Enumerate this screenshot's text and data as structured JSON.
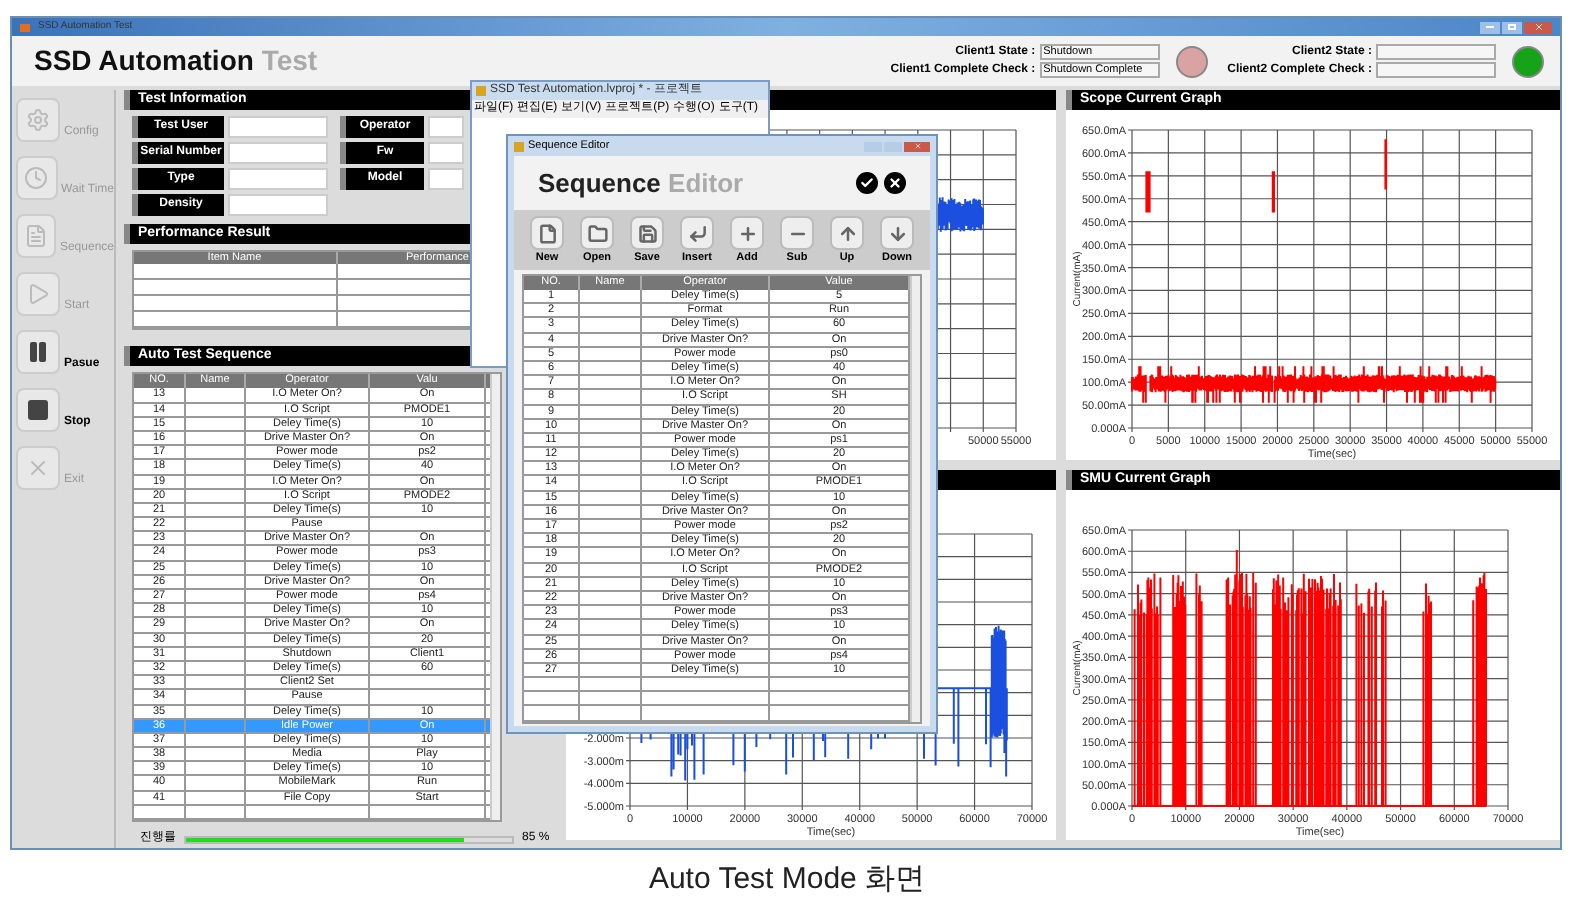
{
  "window": {
    "title": "SSD Automation Test"
  },
  "header": {
    "title": "SSD Automation",
    "title_suffix": "Test"
  },
  "clients": [
    {
      "state_label": "Client1 State :",
      "state": "Shutdown",
      "check_label": "Client1 Complete Check :",
      "check": "Shutdown Complete",
      "color": "#d9a3a3"
    },
    {
      "state_label": "Client2 State :",
      "check_label": "Client2 Complete Check :",
      "color": "#17a317"
    }
  ],
  "sidebar": [
    {
      "label": "Config",
      "disabled": true
    },
    {
      "label": "Wait Time",
      "disabled": true
    },
    {
      "label": "Sequence",
      "disabled": true
    },
    {
      "label": "Start",
      "disabled": true
    },
    {
      "label": "Pasue",
      "disabled": false
    },
    {
      "label": "Stop",
      "disabled": false
    },
    {
      "label": "Exit",
      "disabled": true
    }
  ],
  "test_information": {
    "title": "Test Information",
    "left_fields": [
      {
        "label": "Test User"
      },
      {
        "label": "Serial Number"
      },
      {
        "label": "Type"
      },
      {
        "label": "Density"
      }
    ],
    "right_fields": [
      {
        "label": "Operator"
      },
      {
        "label": "Fw"
      },
      {
        "label": "Model"
      }
    ]
  },
  "performance_result": {
    "title": "Performance Result",
    "columns": [
      "Item Name",
      "Performance"
    ]
  },
  "auto_test_sequence": {
    "title": "Auto Test Sequence",
    "columns": [
      "NO.",
      "Name",
      "Operator",
      "Valu"
    ],
    "rows": [
      {
        "no": "13",
        "operator": "I.O Meter On?",
        "value": "On",
        "selected": false
      },
      {
        "no": "14",
        "operator": "I.O Script",
        "value": "PMODE1",
        "selected": false
      },
      {
        "no": "15",
        "operator": "Deley Time(s)",
        "value": "10",
        "selected": false
      },
      {
        "no": "16",
        "operator": "Drive Master On?",
        "value": "On",
        "selected": false
      },
      {
        "no": "17",
        "operator": "Power mode",
        "value": "ps2",
        "selected": false
      },
      {
        "no": "18",
        "operator": "Deley Time(s)",
        "value": "40",
        "selected": false
      },
      {
        "no": "19",
        "operator": "I.O Meter On?",
        "value": "On",
        "selected": false
      },
      {
        "no": "20",
        "operator": "I.O Script",
        "value": "PMODE2",
        "selected": false
      },
      {
        "no": "21",
        "operator": "Deley Time(s)",
        "value": "10",
        "selected": false
      },
      {
        "no": "22",
        "operator": "Pause",
        "selected": false
      },
      {
        "no": "23",
        "operator": "Drive Master On?",
        "value": "On",
        "selected": false
      },
      {
        "no": "24",
        "operator": "Power mode",
        "value": "ps3",
        "selected": false
      },
      {
        "no": "25",
        "operator": "Deley Time(s)",
        "value": "10",
        "selected": false
      },
      {
        "no": "26",
        "operator": "Drive Master On?",
        "value": "On",
        "selected": false
      },
      {
        "no": "27",
        "operator": "Power mode",
        "value": "ps4",
        "selected": false
      },
      {
        "no": "28",
        "operator": "Deley Time(s)",
        "value": "10",
        "selected": false
      },
      {
        "no": "29",
        "operator": "Drive Master On?",
        "value": "On",
        "selected": false
      },
      {
        "no": "30",
        "operator": "Deley Time(s)",
        "value": "20",
        "selected": false
      },
      {
        "no": "31",
        "operator": "Shutdown",
        "value": "Client1",
        "selected": false
      },
      {
        "no": "32",
        "operator": "Deley Time(s)",
        "value": "60",
        "selected": false
      },
      {
        "no": "33",
        "operator": "Client2 Set",
        "selected": false
      },
      {
        "no": "34",
        "operator": "Pause",
        "selected": false
      },
      {
        "no": "35",
        "operator": "Deley Time(s)",
        "value": "10",
        "selected": false
      },
      {
        "no": "36",
        "operator": "Idle Power",
        "value": "On",
        "selected": true
      },
      {
        "no": "37",
        "operator": "Deley Time(s)",
        "value": "10",
        "selected": false
      },
      {
        "no": "38",
        "operator": "Media",
        "value": "Play",
        "selected": false
      },
      {
        "no": "39",
        "operator": "Deley Time(s)",
        "value": "10",
        "selected": false
      },
      {
        "no": "40",
        "operator": "MobileMark",
        "value": "Run",
        "selected": false
      },
      {
        "no": "41",
        "operator": "File Copy",
        "value": "Start",
        "selected": false
      }
    ],
    "progress": {
      "label": "진행률",
      "level": 0.85,
      "reading": "85 %"
    }
  },
  "middle_top_graph": {
    "x_ticks": [
      "50000",
      "55000"
    ]
  },
  "middle_bottom_graph": {
    "y_ticks": [
      "-2.000m",
      "-3.000m",
      "-4.000m",
      "-5.000m"
    ],
    "x_ticks": [
      "0",
      "10000",
      "20000",
      "30000",
      "40000",
      "50000",
      "60000",
      "70000"
    ],
    "xlabel": "Time(sec)"
  },
  "scope_graph": {
    "title": "Scope Current Graph",
    "ylabel": "Current(mA)",
    "xlabel": "Time(sec)",
    "y_ticks": [
      "650.0mA",
      "600.0mA",
      "550.0mA",
      "500.0mA",
      "450.0mA",
      "400.0mA",
      "350.0mA",
      "300.0mA",
      "250.0mA",
      "200.0mA",
      "150.0mA",
      "100.0mA",
      "50.00mA",
      "0.000A"
    ],
    "x_ticks": [
      "0",
      "5000",
      "10000",
      "15000",
      "20000",
      "25000",
      "30000",
      "35000",
      "40000",
      "45000",
      "50000",
      "55000"
    ]
  },
  "smu_graph": {
    "title": "SMU Current Graph",
    "ylabel": "Current(mA)",
    "xlabel": "Time(sec)",
    "y_ticks": [
      "650.0mA",
      "600.0mA",
      "550.0mA",
      "500.0mA",
      "450.0mA",
      "400.0mA",
      "350.0mA",
      "300.0mA",
      "250.0mA",
      "200.0mA",
      "150.0mA",
      "100.0mA",
      "50.00mA",
      "0.000A"
    ],
    "x_ticks": [
      "0",
      "10000",
      "20000",
      "30000",
      "40000",
      "50000",
      "60000",
      "70000"
    ]
  },
  "project_window": {
    "title": "SSD Test Automation.lvproj * - 프로젝트",
    "menu": [
      "파일(F)",
      "편집(E)",
      "보기(V)",
      "프로젝트(P)",
      "수행(O)",
      "도구(T)"
    ]
  },
  "sequence_editor": {
    "window_title": "Sequence Editor",
    "title": "Sequence",
    "title_suffix": "Editor",
    "toolbar": [
      {
        "label": "New"
      },
      {
        "label": "Open"
      },
      {
        "label": "Save"
      },
      {
        "label": "Insert"
      },
      {
        "label": "Add"
      },
      {
        "label": "Sub"
      },
      {
        "label": "Up"
      },
      {
        "label": "Down"
      }
    ],
    "columns": [
      "NO.",
      "Name",
      "Operator",
      "Value"
    ],
    "rows": [
      {
        "no": "1",
        "operator": "Deley Time(s)",
        "value": "5"
      },
      {
        "no": "2",
        "operator": "Format",
        "value": "Run"
      },
      {
        "no": "3",
        "operator": "Deley Time(s)",
        "value": "60"
      },
      {
        "no": "4",
        "operator": "Drive Master On?",
        "value": "On"
      },
      {
        "no": "5",
        "operator": "Power mode",
        "value": "ps0"
      },
      {
        "no": "6",
        "operator": "Deley Time(s)",
        "value": "40"
      },
      {
        "no": "7",
        "operator": "I.O Meter On?",
        "value": "On"
      },
      {
        "no": "8",
        "operator": "I.O Script",
        "value": "SH"
      },
      {
        "no": "9",
        "operator": "Deley Time(s)",
        "value": "20"
      },
      {
        "no": "10",
        "operator": "Drive Master On?",
        "value": "On"
      },
      {
        "no": "11",
        "operator": "Power mode",
        "value": "ps1"
      },
      {
        "no": "12",
        "operator": "Deley Time(s)",
        "value": "20"
      },
      {
        "no": "13",
        "operator": "I.O Meter On?",
        "value": "On"
      },
      {
        "no": "14",
        "operator": "I.O Script",
        "value": "PMODE1"
      },
      {
        "no": "15",
        "operator": "Deley Time(s)",
        "value": "10"
      },
      {
        "no": "16",
        "operator": "Drive Master On?",
        "value": "On"
      },
      {
        "no": "17",
        "operator": "Power mode",
        "value": "ps2"
      },
      {
        "no": "18",
        "operator": "Deley Time(s)",
        "value": "20"
      },
      {
        "no": "19",
        "operator": "I.O Meter On?",
        "value": "On"
      },
      {
        "no": "20",
        "operator": "I.O Script",
        "value": "PMODE2"
      },
      {
        "no": "21",
        "operator": "Deley Time(s)",
        "value": "10"
      },
      {
        "no": "22",
        "operator": "Drive Master On?",
        "value": "On"
      },
      {
        "no": "23",
        "operator": "Power mode",
        "value": "ps3"
      },
      {
        "no": "24",
        "operator": "Deley Time(s)",
        "value": "10"
      },
      {
        "no": "25",
        "operator": "Drive Master On?",
        "value": "On"
      },
      {
        "no": "26",
        "operator": "Power mode",
        "value": "ps4"
      },
      {
        "no": "27",
        "operator": "Deley Time(s)",
        "value": "10"
      }
    ]
  },
  "caption": "Auto Test Mode 화면"
}
